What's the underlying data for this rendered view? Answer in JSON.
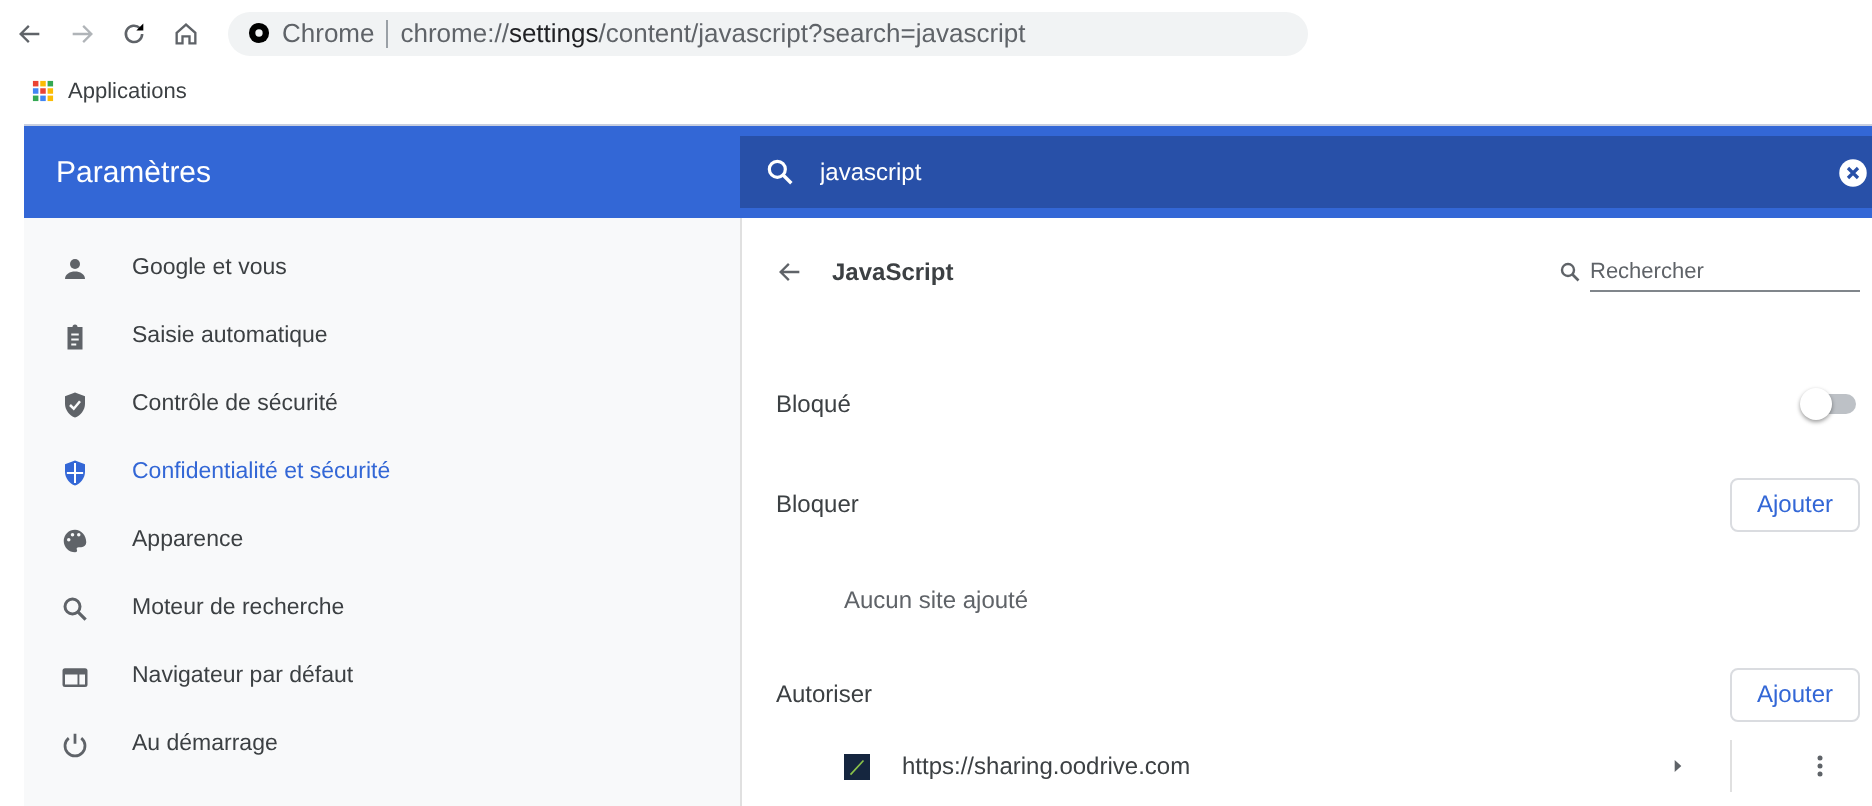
{
  "toolbar": {
    "site_label": "Chrome",
    "url_host": "chrome://",
    "url_bold": "settings",
    "url_rest": "/content/javascript?search=javascript"
  },
  "bookmarks": [
    {
      "label": "Applications"
    }
  ],
  "header": {
    "title": "Paramètres",
    "search_value": "javascript"
  },
  "sidebar": {
    "items": [
      {
        "label": "Google et vous",
        "selected": false
      },
      {
        "label": "Saisie automatique",
        "selected": false
      },
      {
        "label": "Contrôle de sécurité",
        "selected": false
      },
      {
        "label": "Confidentialité et sécurité",
        "selected": true
      },
      {
        "label": "Apparence",
        "selected": false
      },
      {
        "label": "Moteur de recherche",
        "selected": false
      },
      {
        "label": "Navigateur par défaut",
        "selected": false
      },
      {
        "label": "Au démarrage",
        "selected": false
      }
    ]
  },
  "page": {
    "title": "JavaScript",
    "search_placeholder": "Rechercher",
    "toggle": {
      "label": "Bloqué",
      "on": false
    },
    "sections": [
      {
        "title": "Bloquer",
        "button": "Ajouter",
        "empty": "Aucun site ajouté"
      },
      {
        "title": "Autoriser",
        "button": "Ajouter",
        "sites": [
          {
            "url": "https://sharing.oodrive.com"
          }
        ]
      }
    ]
  }
}
